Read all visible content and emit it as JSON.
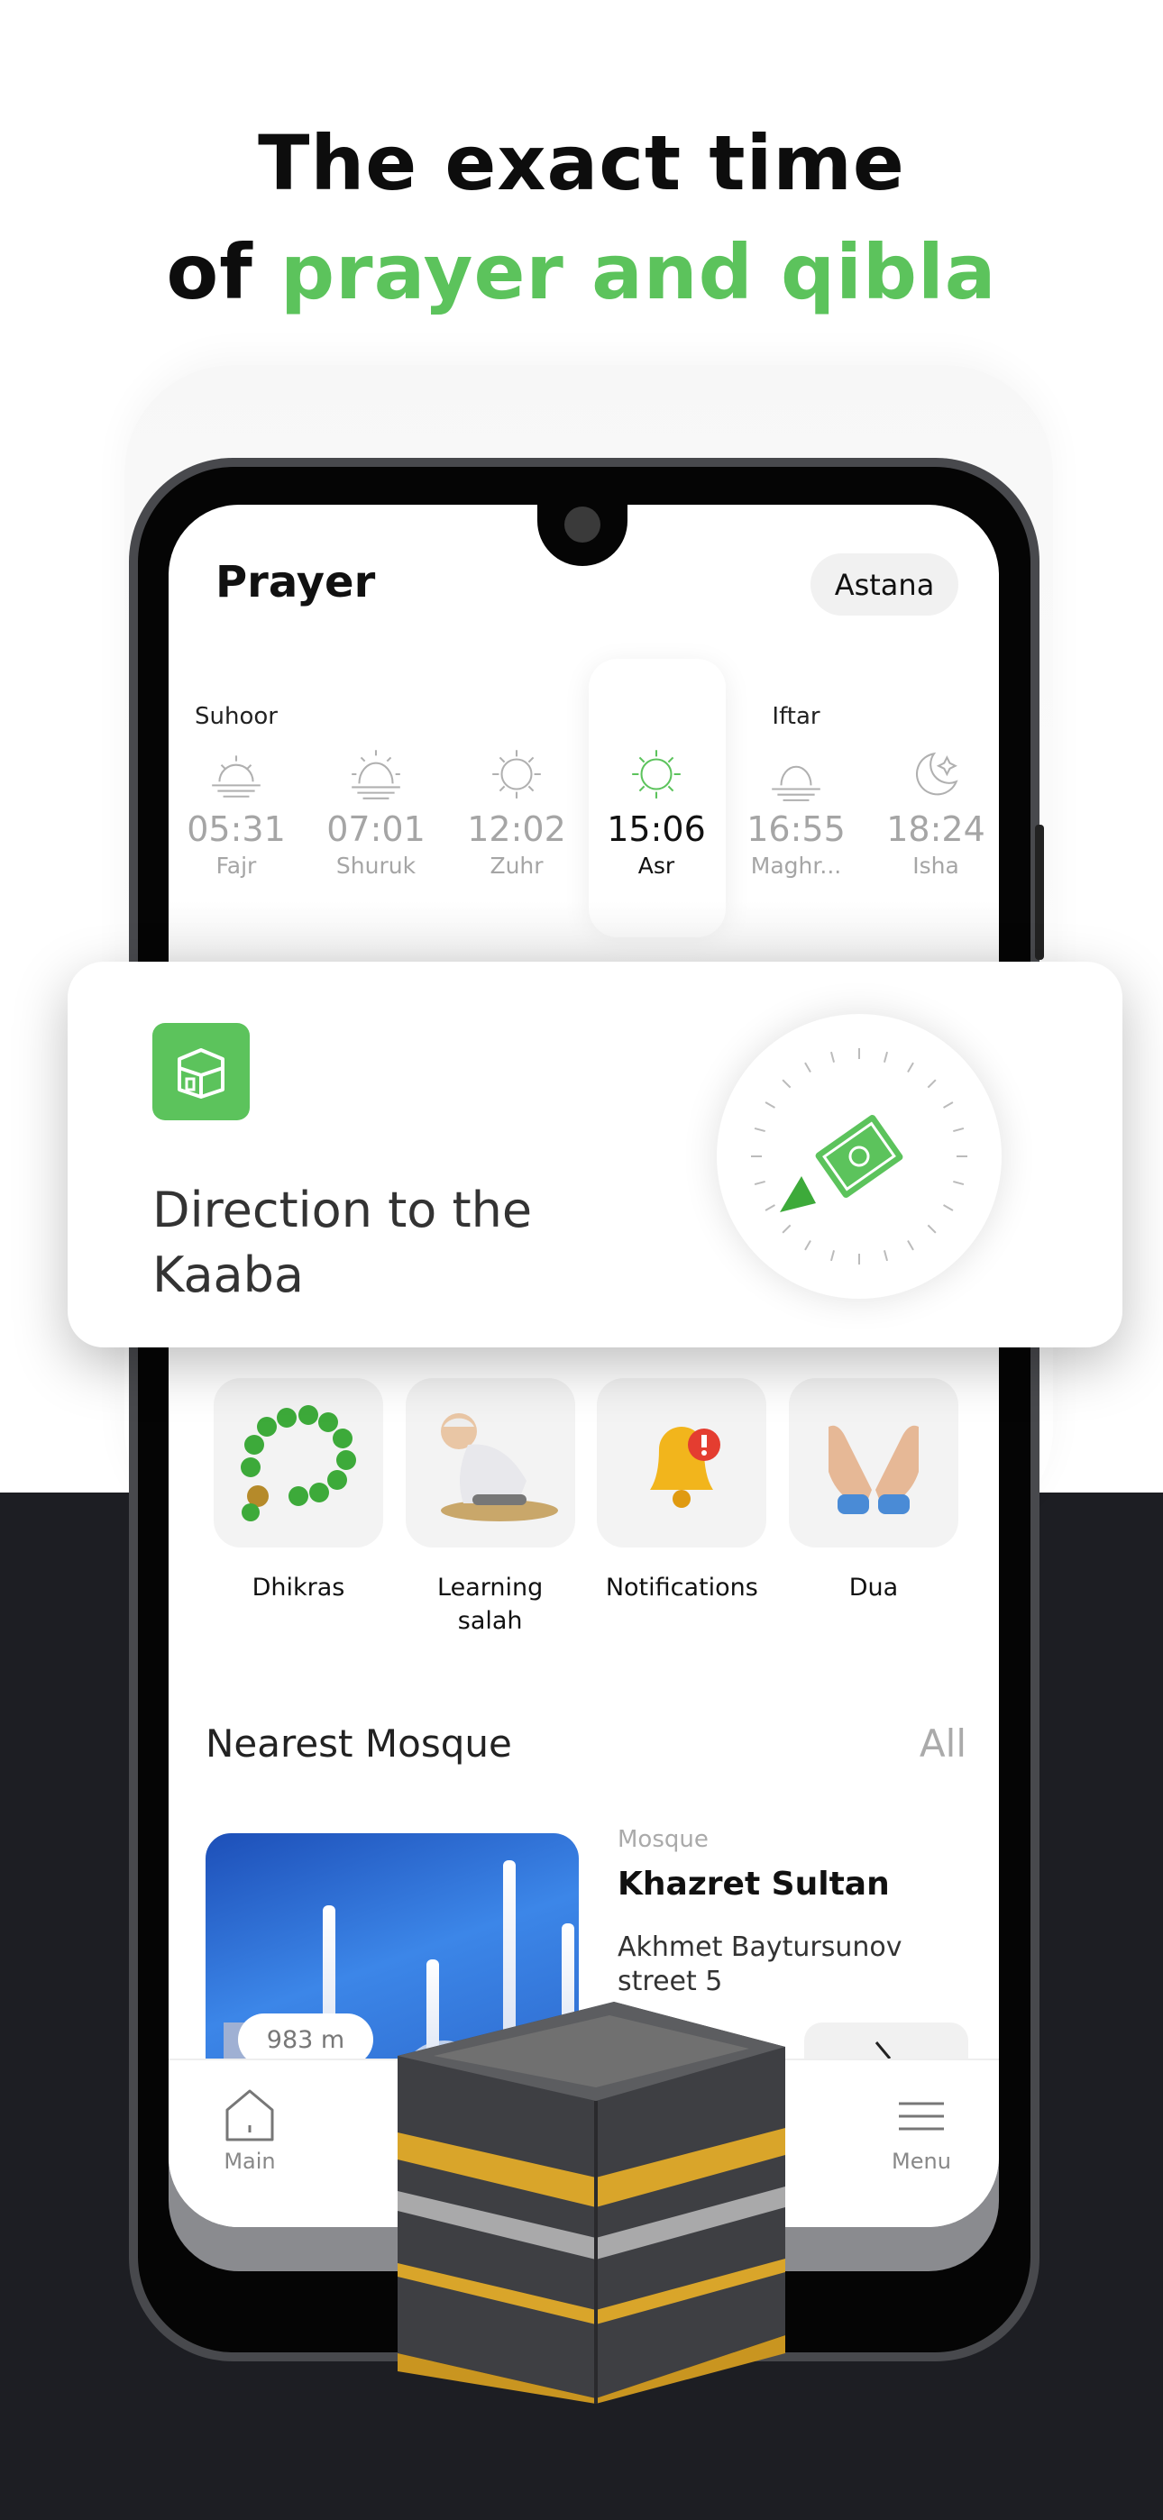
{
  "headline": {
    "line1": "The exact time",
    "line2_prefix": "of ",
    "line2_highlight": "prayer and qibla"
  },
  "colors": {
    "accent": "#5cc35c",
    "dark_bg": "#1d1e23"
  },
  "header": {
    "title": "Prayer",
    "city": "Astana"
  },
  "prayers": [
    {
      "tag": "Suhoor",
      "time": "05:31",
      "name": "Fajr",
      "icon": "sunrise-icon"
    },
    {
      "tag": "",
      "time": "07:01",
      "name": "Shuruk",
      "icon": "sunrise-full-icon"
    },
    {
      "tag": "",
      "time": "12:02",
      "name": "Zuhr",
      "icon": "sun-icon"
    },
    {
      "tag": "",
      "time": "15:06",
      "name": "Asr",
      "icon": "sun-icon",
      "active": true
    },
    {
      "tag": "Iftar",
      "time": "16:55",
      "name": "Maghr...",
      "icon": "sunset-icon"
    },
    {
      "tag": "",
      "time": "18:24",
      "name": "Isha",
      "icon": "moon-stars-icon"
    }
  ],
  "qibla": {
    "title_line1": "Direction to the",
    "title_line2": "Kaaba",
    "icon": "kaaba-icon"
  },
  "shortcuts": [
    {
      "label": "Dhikras",
      "icon": "prayer-beads-icon"
    },
    {
      "label": "Learning salah",
      "icon": "praying-person-icon"
    },
    {
      "label": "Notifications",
      "icon": "bell-icon"
    },
    {
      "label": "Dua",
      "icon": "open-hands-icon"
    }
  ],
  "nearest": {
    "title": "Nearest Mosque",
    "all_label": "All",
    "mosque": {
      "type": "Mosque",
      "name": "Khazret Sultan",
      "address": "Akhmet Baytursunov street 5",
      "distance": "983 m"
    }
  },
  "tabs": [
    {
      "label": "Main",
      "icon": "home-icon"
    },
    {
      "label": "Menu",
      "icon": "menu-icon"
    }
  ]
}
